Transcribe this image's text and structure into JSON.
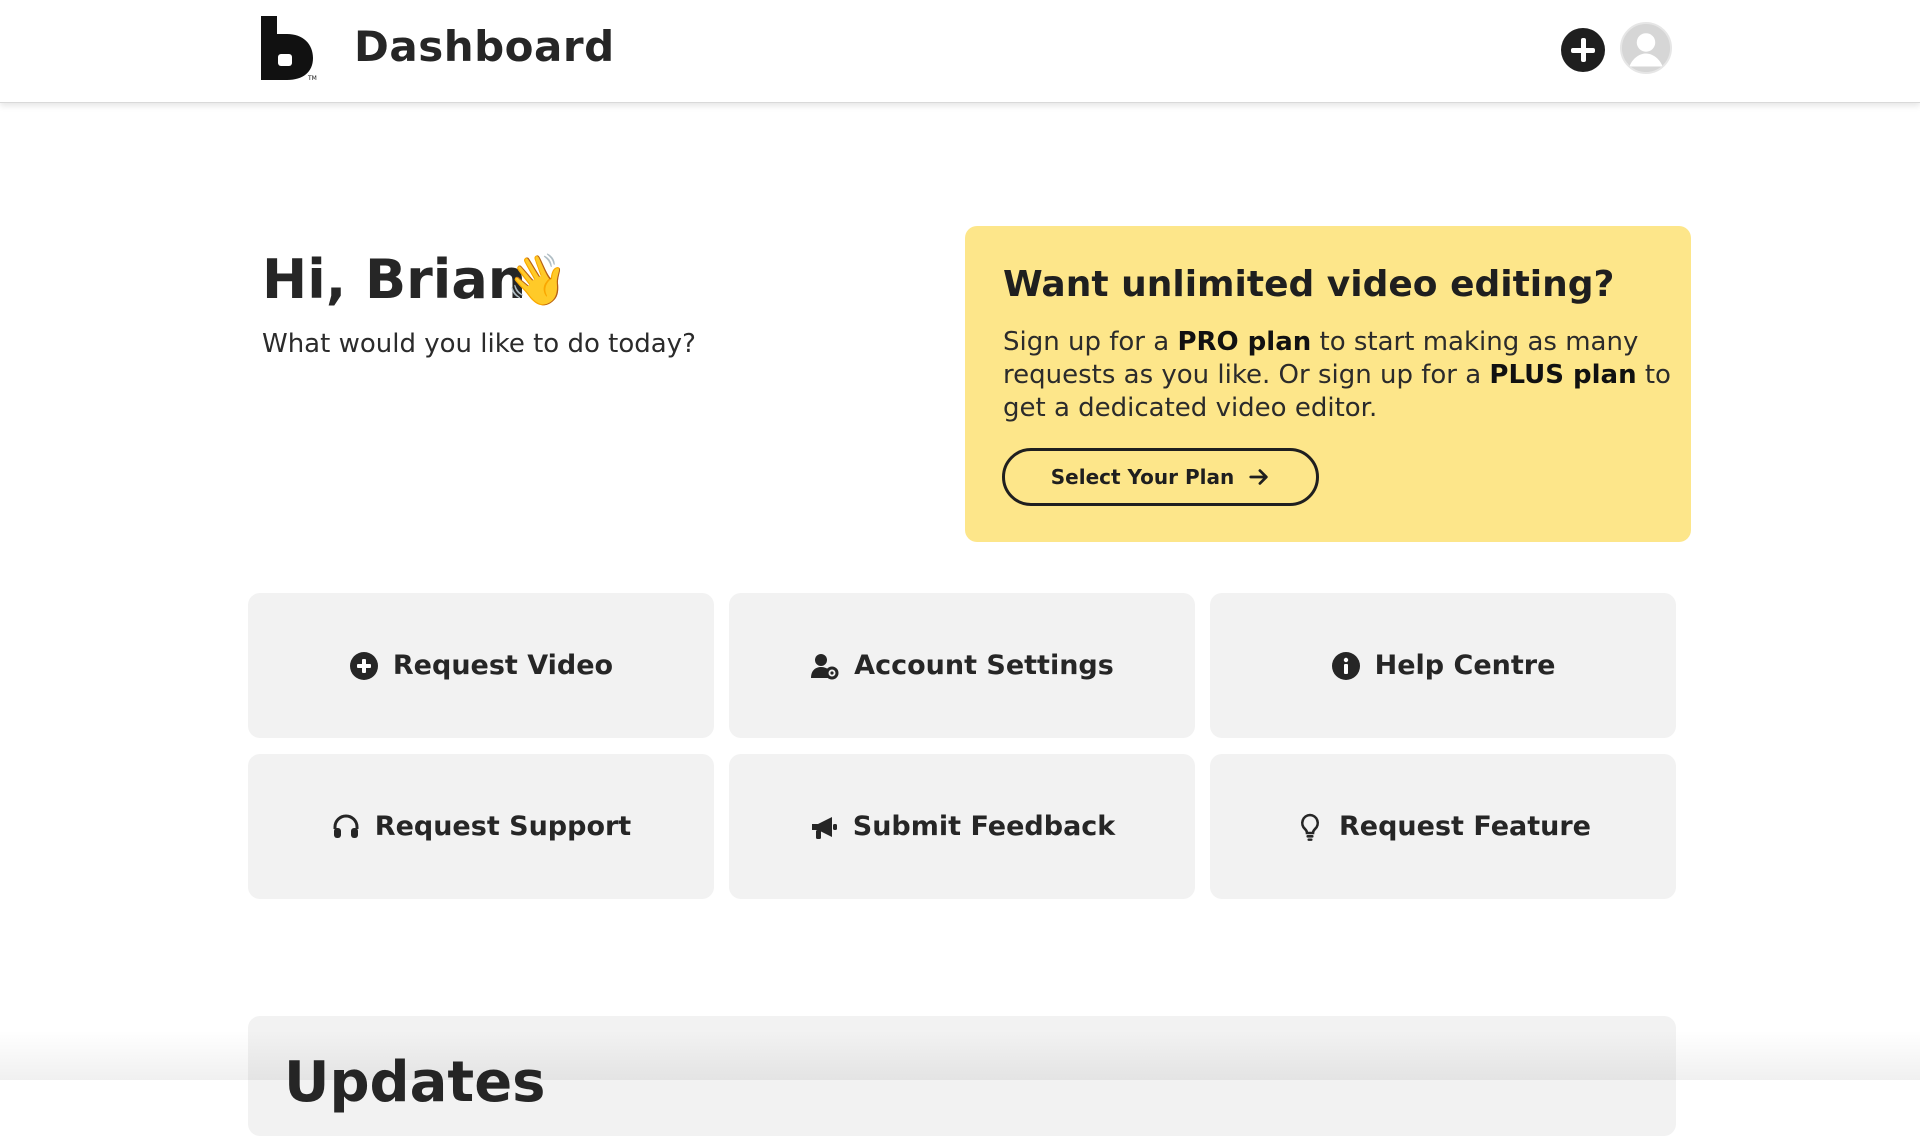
{
  "header": {
    "title": "Dashboard",
    "logo_icon": "brand-b-logo",
    "add_icon": "plus-circle-icon",
    "avatar_icon": "user-avatar-icon"
  },
  "hero": {
    "greeting": "Hi, Brian",
    "wave": "👋",
    "subtitle": "What would you like to do today?"
  },
  "promo": {
    "title": "Want unlimited video editing?",
    "body_1": "Sign up for a ",
    "body_pro": "PRO plan",
    "body_2": " to start making as many requests as you like. Or sign up for a ",
    "body_plus": "PLUS plan",
    "body_3": " to get a dedicated video editor.",
    "button_label": "Select Your Plan",
    "button_icon": "arrow-right-icon",
    "background_color": "#fde68a"
  },
  "actions": [
    {
      "label": "Request Video",
      "icon": "plus-circle-icon"
    },
    {
      "label": "Account Settings",
      "icon": "user-gear-icon"
    },
    {
      "label": "Help Centre",
      "icon": "info-circle-icon"
    },
    {
      "label": "Request Support",
      "icon": "headset-icon"
    },
    {
      "label": "Submit Feedback",
      "icon": "megaphone-icon"
    },
    {
      "label": "Request Feature",
      "icon": "lightbulb-icon"
    }
  ],
  "updates": {
    "title": "Updates"
  }
}
